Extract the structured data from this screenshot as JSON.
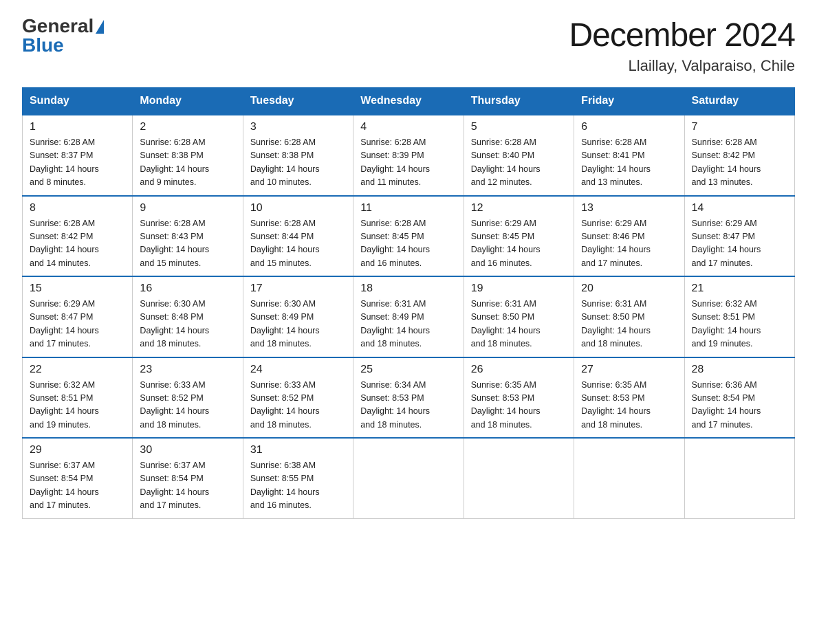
{
  "header": {
    "logo_general": "General",
    "logo_blue": "Blue",
    "month_title": "December 2024",
    "location": "Llaillay, Valparaiso, Chile"
  },
  "weekdays": [
    "Sunday",
    "Monday",
    "Tuesday",
    "Wednesday",
    "Thursday",
    "Friday",
    "Saturday"
  ],
  "weeks": [
    [
      {
        "day": "1",
        "sunrise": "6:28 AM",
        "sunset": "8:37 PM",
        "daylight": "14 hours and 8 minutes."
      },
      {
        "day": "2",
        "sunrise": "6:28 AM",
        "sunset": "8:38 PM",
        "daylight": "14 hours and 9 minutes."
      },
      {
        "day": "3",
        "sunrise": "6:28 AM",
        "sunset": "8:38 PM",
        "daylight": "14 hours and 10 minutes."
      },
      {
        "day": "4",
        "sunrise": "6:28 AM",
        "sunset": "8:39 PM",
        "daylight": "14 hours and 11 minutes."
      },
      {
        "day": "5",
        "sunrise": "6:28 AM",
        "sunset": "8:40 PM",
        "daylight": "14 hours and 12 minutes."
      },
      {
        "day": "6",
        "sunrise": "6:28 AM",
        "sunset": "8:41 PM",
        "daylight": "14 hours and 13 minutes."
      },
      {
        "day": "7",
        "sunrise": "6:28 AM",
        "sunset": "8:42 PM",
        "daylight": "14 hours and 13 minutes."
      }
    ],
    [
      {
        "day": "8",
        "sunrise": "6:28 AM",
        "sunset": "8:42 PM",
        "daylight": "14 hours and 14 minutes."
      },
      {
        "day": "9",
        "sunrise": "6:28 AM",
        "sunset": "8:43 PM",
        "daylight": "14 hours and 15 minutes."
      },
      {
        "day": "10",
        "sunrise": "6:28 AM",
        "sunset": "8:44 PM",
        "daylight": "14 hours and 15 minutes."
      },
      {
        "day": "11",
        "sunrise": "6:28 AM",
        "sunset": "8:45 PM",
        "daylight": "14 hours and 16 minutes."
      },
      {
        "day": "12",
        "sunrise": "6:29 AM",
        "sunset": "8:45 PM",
        "daylight": "14 hours and 16 minutes."
      },
      {
        "day": "13",
        "sunrise": "6:29 AM",
        "sunset": "8:46 PM",
        "daylight": "14 hours and 17 minutes."
      },
      {
        "day": "14",
        "sunrise": "6:29 AM",
        "sunset": "8:47 PM",
        "daylight": "14 hours and 17 minutes."
      }
    ],
    [
      {
        "day": "15",
        "sunrise": "6:29 AM",
        "sunset": "8:47 PM",
        "daylight": "14 hours and 17 minutes."
      },
      {
        "day": "16",
        "sunrise": "6:30 AM",
        "sunset": "8:48 PM",
        "daylight": "14 hours and 18 minutes."
      },
      {
        "day": "17",
        "sunrise": "6:30 AM",
        "sunset": "8:49 PM",
        "daylight": "14 hours and 18 minutes."
      },
      {
        "day": "18",
        "sunrise": "6:31 AM",
        "sunset": "8:49 PM",
        "daylight": "14 hours and 18 minutes."
      },
      {
        "day": "19",
        "sunrise": "6:31 AM",
        "sunset": "8:50 PM",
        "daylight": "14 hours and 18 minutes."
      },
      {
        "day": "20",
        "sunrise": "6:31 AM",
        "sunset": "8:50 PM",
        "daylight": "14 hours and 18 minutes."
      },
      {
        "day": "21",
        "sunrise": "6:32 AM",
        "sunset": "8:51 PM",
        "daylight": "14 hours and 19 minutes."
      }
    ],
    [
      {
        "day": "22",
        "sunrise": "6:32 AM",
        "sunset": "8:51 PM",
        "daylight": "14 hours and 19 minutes."
      },
      {
        "day": "23",
        "sunrise": "6:33 AM",
        "sunset": "8:52 PM",
        "daylight": "14 hours and 18 minutes."
      },
      {
        "day": "24",
        "sunrise": "6:33 AM",
        "sunset": "8:52 PM",
        "daylight": "14 hours and 18 minutes."
      },
      {
        "day": "25",
        "sunrise": "6:34 AM",
        "sunset": "8:53 PM",
        "daylight": "14 hours and 18 minutes."
      },
      {
        "day": "26",
        "sunrise": "6:35 AM",
        "sunset": "8:53 PM",
        "daylight": "14 hours and 18 minutes."
      },
      {
        "day": "27",
        "sunrise": "6:35 AM",
        "sunset": "8:53 PM",
        "daylight": "14 hours and 18 minutes."
      },
      {
        "day": "28",
        "sunrise": "6:36 AM",
        "sunset": "8:54 PM",
        "daylight": "14 hours and 17 minutes."
      }
    ],
    [
      {
        "day": "29",
        "sunrise": "6:37 AM",
        "sunset": "8:54 PM",
        "daylight": "14 hours and 17 minutes."
      },
      {
        "day": "30",
        "sunrise": "6:37 AM",
        "sunset": "8:54 PM",
        "daylight": "14 hours and 17 minutes."
      },
      {
        "day": "31",
        "sunrise": "6:38 AM",
        "sunset": "8:55 PM",
        "daylight": "14 hours and 16 minutes."
      },
      null,
      null,
      null,
      null
    ]
  ],
  "labels": {
    "sunrise": "Sunrise:",
    "sunset": "Sunset:",
    "daylight": "Daylight:"
  }
}
